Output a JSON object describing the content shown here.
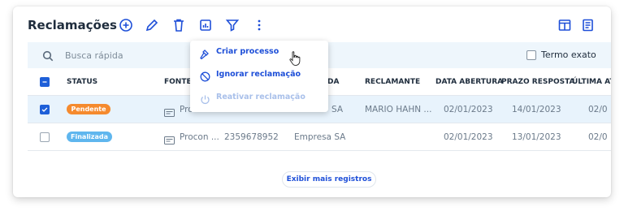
{
  "header": {
    "title": "Reclamações"
  },
  "search": {
    "placeholder": "Busca rápida",
    "exact_label": "Termo exato"
  },
  "table": {
    "columns": [
      "STATUS",
      "FONTE/C",
      "DA",
      "RECLAMANTE",
      "DATA ABERTURA",
      "PRAZO RESPOSTA",
      "ÚLTIMA AT"
    ],
    "rows": [
      {
        "status": "Pendente",
        "fonte": "Pro",
        "numero": "",
        "empresa": "SA",
        "reclamante": "MARIO HAHN ...",
        "abertura": "02/01/2023",
        "prazo": "14/01/2023",
        "ultima": "02/0"
      },
      {
        "status": "Finalizada",
        "fonte": "Procon ...",
        "numero": "2359678952",
        "empresa": "Empresa SA",
        "reclamante": "",
        "abertura": "02/01/2023",
        "prazo": "13/01/2023",
        "ultima": "02/0"
      }
    ]
  },
  "menu": {
    "items": [
      "Criar processo",
      "Ignorar reclamação",
      "Reativar reclamação"
    ]
  },
  "footer": {
    "more_label": "Exibir mais registros"
  },
  "colors": {
    "accent": "#1e4fd8",
    "pending": "#f58a2e",
    "finished": "#5fb6ee",
    "selected_row": "#e8f3fc"
  },
  "icons": [
    "add-circle-icon",
    "pencil-icon",
    "trash-icon",
    "report-icon",
    "filter-icon",
    "more-vertical-icon",
    "columns-icon",
    "book-icon",
    "search-icon",
    "hammer-icon",
    "block-icon",
    "power-icon",
    "document-icon",
    "hand-cursor-icon"
  ]
}
